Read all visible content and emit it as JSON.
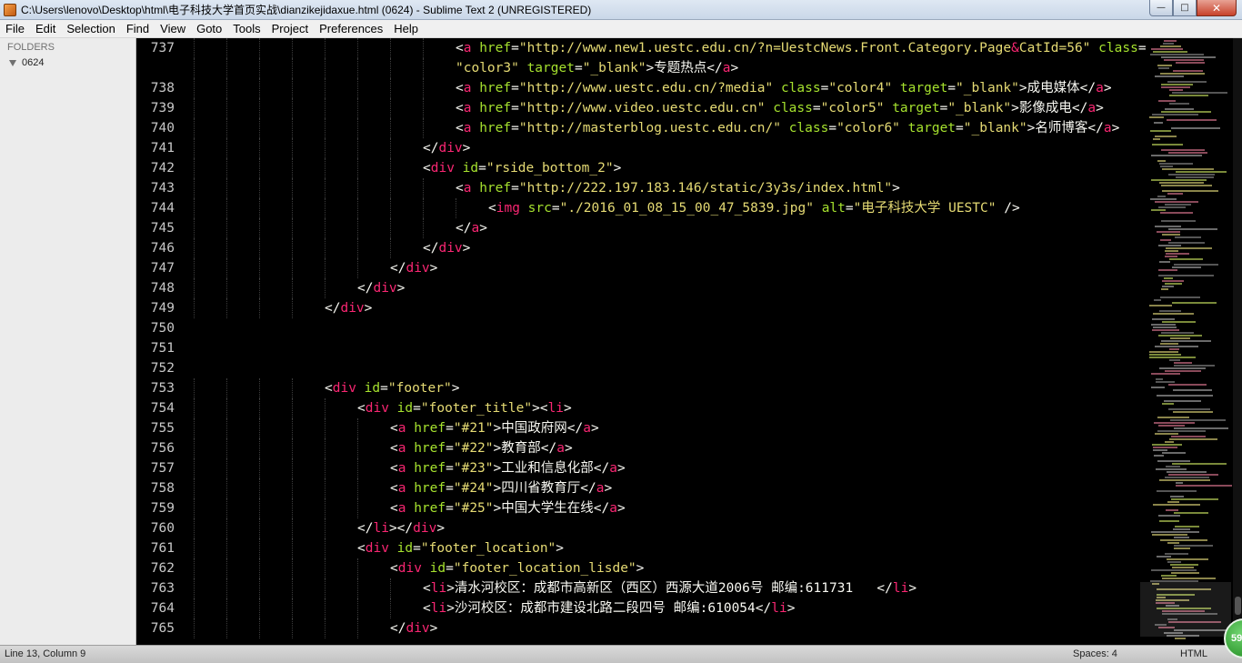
{
  "window": {
    "title": "C:\\Users\\lenovo\\Desktop\\html\\电子科技大学首页实战\\dianzikejidaxue.html (0624) - Sublime Text 2 (UNREGISTERED)",
    "minimize": "0",
    "maximize": "1",
    "close": "r"
  },
  "menu": [
    "File",
    "Edit",
    "Selection",
    "Find",
    "View",
    "Goto",
    "Tools",
    "Project",
    "Preferences",
    "Help"
  ],
  "sidebar": {
    "header": "FOLDERS",
    "folder": "0624"
  },
  "editor": {
    "lines": [
      {
        "n": "737",
        "indent": 8,
        "tokens": [
          [
            "p",
            "<"
          ],
          [
            "tag",
            "a"
          ],
          [
            "p",
            " "
          ],
          [
            "attr",
            "href"
          ],
          [
            "p",
            "="
          ],
          [
            "str",
            "\"http://www.new1.uestc.edu.cn/?n=UestcNews.Front.Category.Page"
          ],
          [
            "amp",
            "&"
          ],
          [
            "str",
            "CatId=56\""
          ],
          [
            "p",
            " "
          ],
          [
            "attr",
            "class"
          ],
          [
            "p",
            "="
          ]
        ]
      },
      {
        "n": "",
        "indent": 8,
        "tokens": [
          [
            "str",
            "\"color3\""
          ],
          [
            "p",
            " "
          ],
          [
            "attr",
            "target"
          ],
          [
            "p",
            "="
          ],
          [
            "str",
            "\"_blank\""
          ],
          [
            "p",
            ">专题热点</"
          ],
          [
            "tag",
            "a"
          ],
          [
            "p",
            ">"
          ]
        ]
      },
      {
        "n": "738",
        "indent": 8,
        "tokens": [
          [
            "p",
            "<"
          ],
          [
            "tag",
            "a"
          ],
          [
            "p",
            " "
          ],
          [
            "attr",
            "href"
          ],
          [
            "p",
            "="
          ],
          [
            "str",
            "\"http://www.uestc.edu.cn/?media\""
          ],
          [
            "p",
            " "
          ],
          [
            "attr",
            "class"
          ],
          [
            "p",
            "="
          ],
          [
            "str",
            "\"color4\""
          ],
          [
            "p",
            " "
          ],
          [
            "attr",
            "target"
          ],
          [
            "p",
            "="
          ],
          [
            "str",
            "\"_blank\""
          ],
          [
            "p",
            ">成电媒体</"
          ],
          [
            "tag",
            "a"
          ],
          [
            "p",
            ">"
          ]
        ]
      },
      {
        "n": "739",
        "indent": 8,
        "tokens": [
          [
            "p",
            "<"
          ],
          [
            "tag",
            "a"
          ],
          [
            "p",
            " "
          ],
          [
            "attr",
            "href"
          ],
          [
            "p",
            "="
          ],
          [
            "str",
            "\"http://www.video.uestc.edu.cn\""
          ],
          [
            "p",
            " "
          ],
          [
            "attr",
            "class"
          ],
          [
            "p",
            "="
          ],
          [
            "str",
            "\"color5\""
          ],
          [
            "p",
            " "
          ],
          [
            "attr",
            "target"
          ],
          [
            "p",
            "="
          ],
          [
            "str",
            "\"_blank\""
          ],
          [
            "p",
            ">影像成电</"
          ],
          [
            "tag",
            "a"
          ],
          [
            "p",
            ">"
          ]
        ]
      },
      {
        "n": "740",
        "indent": 8,
        "tokens": [
          [
            "p",
            "<"
          ],
          [
            "tag",
            "a"
          ],
          [
            "p",
            " "
          ],
          [
            "attr",
            "href"
          ],
          [
            "p",
            "="
          ],
          [
            "str",
            "\"http://masterblog.uestc.edu.cn/\""
          ],
          [
            "p",
            " "
          ],
          [
            "attr",
            "class"
          ],
          [
            "p",
            "="
          ],
          [
            "str",
            "\"color6\""
          ],
          [
            "p",
            " "
          ],
          [
            "attr",
            "target"
          ],
          [
            "p",
            "="
          ],
          [
            "str",
            "\"_blank\""
          ],
          [
            "p",
            ">名师博客</"
          ],
          [
            "tag",
            "a"
          ],
          [
            "p",
            ">"
          ]
        ]
      },
      {
        "n": "741",
        "indent": 7,
        "tokens": [
          [
            "p",
            "</"
          ],
          [
            "tag",
            "div"
          ],
          [
            "p",
            ">"
          ]
        ]
      },
      {
        "n": "742",
        "indent": 7,
        "tokens": [
          [
            "p",
            "<"
          ],
          [
            "tag",
            "div"
          ],
          [
            "p",
            " "
          ],
          [
            "attr",
            "id"
          ],
          [
            "p",
            "="
          ],
          [
            "str",
            "\"rside_bottom_2\""
          ],
          [
            "p",
            ">"
          ]
        ]
      },
      {
        "n": "743",
        "indent": 8,
        "tokens": [
          [
            "p",
            "<"
          ],
          [
            "tag",
            "a"
          ],
          [
            "p",
            " "
          ],
          [
            "attr",
            "href"
          ],
          [
            "p",
            "="
          ],
          [
            "str",
            "\"http://222.197.183.146/static/3y3s/index.html\""
          ],
          [
            "p",
            ">"
          ]
        ]
      },
      {
        "n": "744",
        "indent": 9,
        "tokens": [
          [
            "p",
            "<"
          ],
          [
            "tag",
            "img"
          ],
          [
            "p",
            " "
          ],
          [
            "attr",
            "src"
          ],
          [
            "p",
            "="
          ],
          [
            "str",
            "\"./2016_01_08_15_00_47_5839.jpg\""
          ],
          [
            "p",
            " "
          ],
          [
            "attr",
            "alt"
          ],
          [
            "p",
            "="
          ],
          [
            "str",
            "\"电子科技大学 UESTC\""
          ],
          [
            "p",
            " />"
          ]
        ]
      },
      {
        "n": "745",
        "indent": 8,
        "tokens": [
          [
            "p",
            "</"
          ],
          [
            "tag",
            "a"
          ],
          [
            "p",
            ">"
          ]
        ]
      },
      {
        "n": "746",
        "indent": 7,
        "tokens": [
          [
            "p",
            "</"
          ],
          [
            "tag",
            "div"
          ],
          [
            "p",
            ">"
          ]
        ]
      },
      {
        "n": "747",
        "indent": 6,
        "tokens": [
          [
            "p",
            "</"
          ],
          [
            "tag",
            "div"
          ],
          [
            "p",
            ">"
          ]
        ]
      },
      {
        "n": "748",
        "indent": 5,
        "tokens": [
          [
            "p",
            "</"
          ],
          [
            "tag",
            "div"
          ],
          [
            "p",
            ">"
          ]
        ]
      },
      {
        "n": "749",
        "indent": 4,
        "tokens": [
          [
            "p",
            "</"
          ],
          [
            "tag",
            "div"
          ],
          [
            "p",
            ">"
          ]
        ]
      },
      {
        "n": "750",
        "indent": 0,
        "tokens": []
      },
      {
        "n": "751",
        "indent": 0,
        "tokens": []
      },
      {
        "n": "752",
        "indent": 0,
        "tokens": []
      },
      {
        "n": "753",
        "indent": 4,
        "tokens": [
          [
            "p",
            "<"
          ],
          [
            "tag",
            "div"
          ],
          [
            "p",
            " "
          ],
          [
            "attr",
            "id"
          ],
          [
            "p",
            "="
          ],
          [
            "str",
            "\"footer\""
          ],
          [
            "p",
            ">"
          ]
        ]
      },
      {
        "n": "754",
        "indent": 5,
        "tokens": [
          [
            "p",
            "<"
          ],
          [
            "tag",
            "div"
          ],
          [
            "p",
            " "
          ],
          [
            "attr",
            "id"
          ],
          [
            "p",
            "="
          ],
          [
            "str",
            "\"footer_title\""
          ],
          [
            "p",
            "><"
          ],
          [
            "tag",
            "li"
          ],
          [
            "p",
            ">"
          ]
        ]
      },
      {
        "n": "755",
        "indent": 6,
        "tokens": [
          [
            "p",
            "<"
          ],
          [
            "tag",
            "a"
          ],
          [
            "p",
            " "
          ],
          [
            "attr",
            "href"
          ],
          [
            "p",
            "="
          ],
          [
            "str",
            "\"#21\""
          ],
          [
            "p",
            ">中国政府网</"
          ],
          [
            "tag",
            "a"
          ],
          [
            "p",
            ">"
          ]
        ]
      },
      {
        "n": "756",
        "indent": 6,
        "tokens": [
          [
            "p",
            "<"
          ],
          [
            "tag",
            "a"
          ],
          [
            "p",
            " "
          ],
          [
            "attr",
            "href"
          ],
          [
            "p",
            "="
          ],
          [
            "str",
            "\"#22\""
          ],
          [
            "p",
            ">教育部</"
          ],
          [
            "tag",
            "a"
          ],
          [
            "p",
            ">"
          ]
        ]
      },
      {
        "n": "757",
        "indent": 6,
        "tokens": [
          [
            "p",
            "<"
          ],
          [
            "tag",
            "a"
          ],
          [
            "p",
            " "
          ],
          [
            "attr",
            "href"
          ],
          [
            "p",
            "="
          ],
          [
            "str",
            "\"#23\""
          ],
          [
            "p",
            ">工业和信息化部</"
          ],
          [
            "tag",
            "a"
          ],
          [
            "p",
            ">"
          ]
        ]
      },
      {
        "n": "758",
        "indent": 6,
        "tokens": [
          [
            "p",
            "<"
          ],
          [
            "tag",
            "a"
          ],
          [
            "p",
            " "
          ],
          [
            "attr",
            "href"
          ],
          [
            "p",
            "="
          ],
          [
            "str",
            "\"#24\""
          ],
          [
            "p",
            ">四川省教育厅</"
          ],
          [
            "tag",
            "a"
          ],
          [
            "p",
            ">"
          ]
        ]
      },
      {
        "n": "759",
        "indent": 6,
        "tokens": [
          [
            "p",
            "<"
          ],
          [
            "tag",
            "a"
          ],
          [
            "p",
            " "
          ],
          [
            "attr",
            "href"
          ],
          [
            "p",
            "="
          ],
          [
            "str",
            "\"#25\""
          ],
          [
            "p",
            ">中国大学生在线</"
          ],
          [
            "tag",
            "a"
          ],
          [
            "p",
            ">"
          ]
        ]
      },
      {
        "n": "760",
        "indent": 5,
        "tokens": [
          [
            "p",
            "</"
          ],
          [
            "tag",
            "li"
          ],
          [
            "p",
            "></"
          ],
          [
            "tag",
            "div"
          ],
          [
            "p",
            ">"
          ]
        ]
      },
      {
        "n": "761",
        "indent": 5,
        "tokens": [
          [
            "p",
            "<"
          ],
          [
            "tag",
            "div"
          ],
          [
            "p",
            " "
          ],
          [
            "attr",
            "id"
          ],
          [
            "p",
            "="
          ],
          [
            "str",
            "\"footer_location\""
          ],
          [
            "p",
            ">"
          ]
        ]
      },
      {
        "n": "762",
        "indent": 6,
        "tokens": [
          [
            "p",
            "<"
          ],
          [
            "tag",
            "div"
          ],
          [
            "p",
            " "
          ],
          [
            "attr",
            "id"
          ],
          [
            "p",
            "="
          ],
          [
            "str",
            "\"footer_location_lisde\""
          ],
          [
            "p",
            ">"
          ]
        ]
      },
      {
        "n": "763",
        "indent": 7,
        "tokens": [
          [
            "p",
            "<"
          ],
          [
            "tag",
            "li"
          ],
          [
            "p",
            ">清水河校区：成都市高新区（西区）西源大道2006号 邮编:611731   </"
          ],
          [
            "tag",
            "li"
          ],
          [
            "p",
            ">"
          ]
        ]
      },
      {
        "n": "764",
        "indent": 7,
        "tokens": [
          [
            "p",
            "<"
          ],
          [
            "tag",
            "li"
          ],
          [
            "p",
            ">沙河校区：成都市建设北路二段四号 邮编:610054</"
          ],
          [
            "tag",
            "li"
          ],
          [
            "p",
            ">"
          ]
        ]
      },
      {
        "n": "765",
        "indent": 6,
        "tokens": [
          [
            "p",
            "</"
          ],
          [
            "tag",
            "div"
          ],
          [
            "p",
            ">"
          ]
        ]
      }
    ]
  },
  "status": {
    "position": "Line 13, Column 9",
    "spaces": "Spaces: 4",
    "syntax": "HTML"
  },
  "badge": "59",
  "colors": {
    "tag": "#f92672",
    "attr": "#a6e22e",
    "string": "#e6db74",
    "text": "#f8f8f2",
    "background": "#000000"
  }
}
